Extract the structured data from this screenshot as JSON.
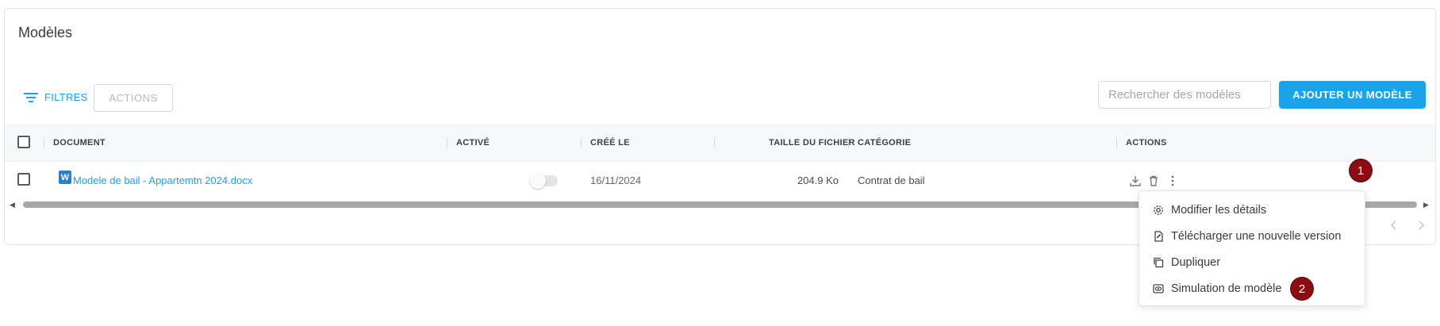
{
  "page": {
    "title": "Modèles"
  },
  "toolbar": {
    "filters_label": "FILTRES",
    "actions_label": "ACTIONS",
    "search_placeholder": "Rechercher des modèles",
    "add_label": "AJOUTER UN MODÈLE"
  },
  "table": {
    "columns": [
      "DOCUMENT",
      "ACTIVÉ",
      "CRÉÉ LE",
      "TAILLE DU FICHIER",
      "CATÉGORIE",
      "ACTIONS"
    ],
    "rows": [
      {
        "document": "Modele de bail - Appartemtn 2024.docx",
        "doc_icon_letter": "W",
        "active": false,
        "created": "16/11/2024",
        "size": "204.9 Ko",
        "category": "Contrat de bail"
      }
    ]
  },
  "context_menu": {
    "items": [
      {
        "label": "Modifier les détails",
        "icon": "gear-icon"
      },
      {
        "label": "Télécharger une nouvelle version",
        "icon": "file-edit-icon"
      },
      {
        "label": "Dupliquer",
        "icon": "copy-icon"
      },
      {
        "label": "Simulation de modèle",
        "icon": "eye-icon"
      }
    ]
  },
  "annotations": {
    "badge_1": "1",
    "badge_2": "2"
  },
  "colors": {
    "accent": "#1aa3e8",
    "badge": "#8b0d12"
  }
}
